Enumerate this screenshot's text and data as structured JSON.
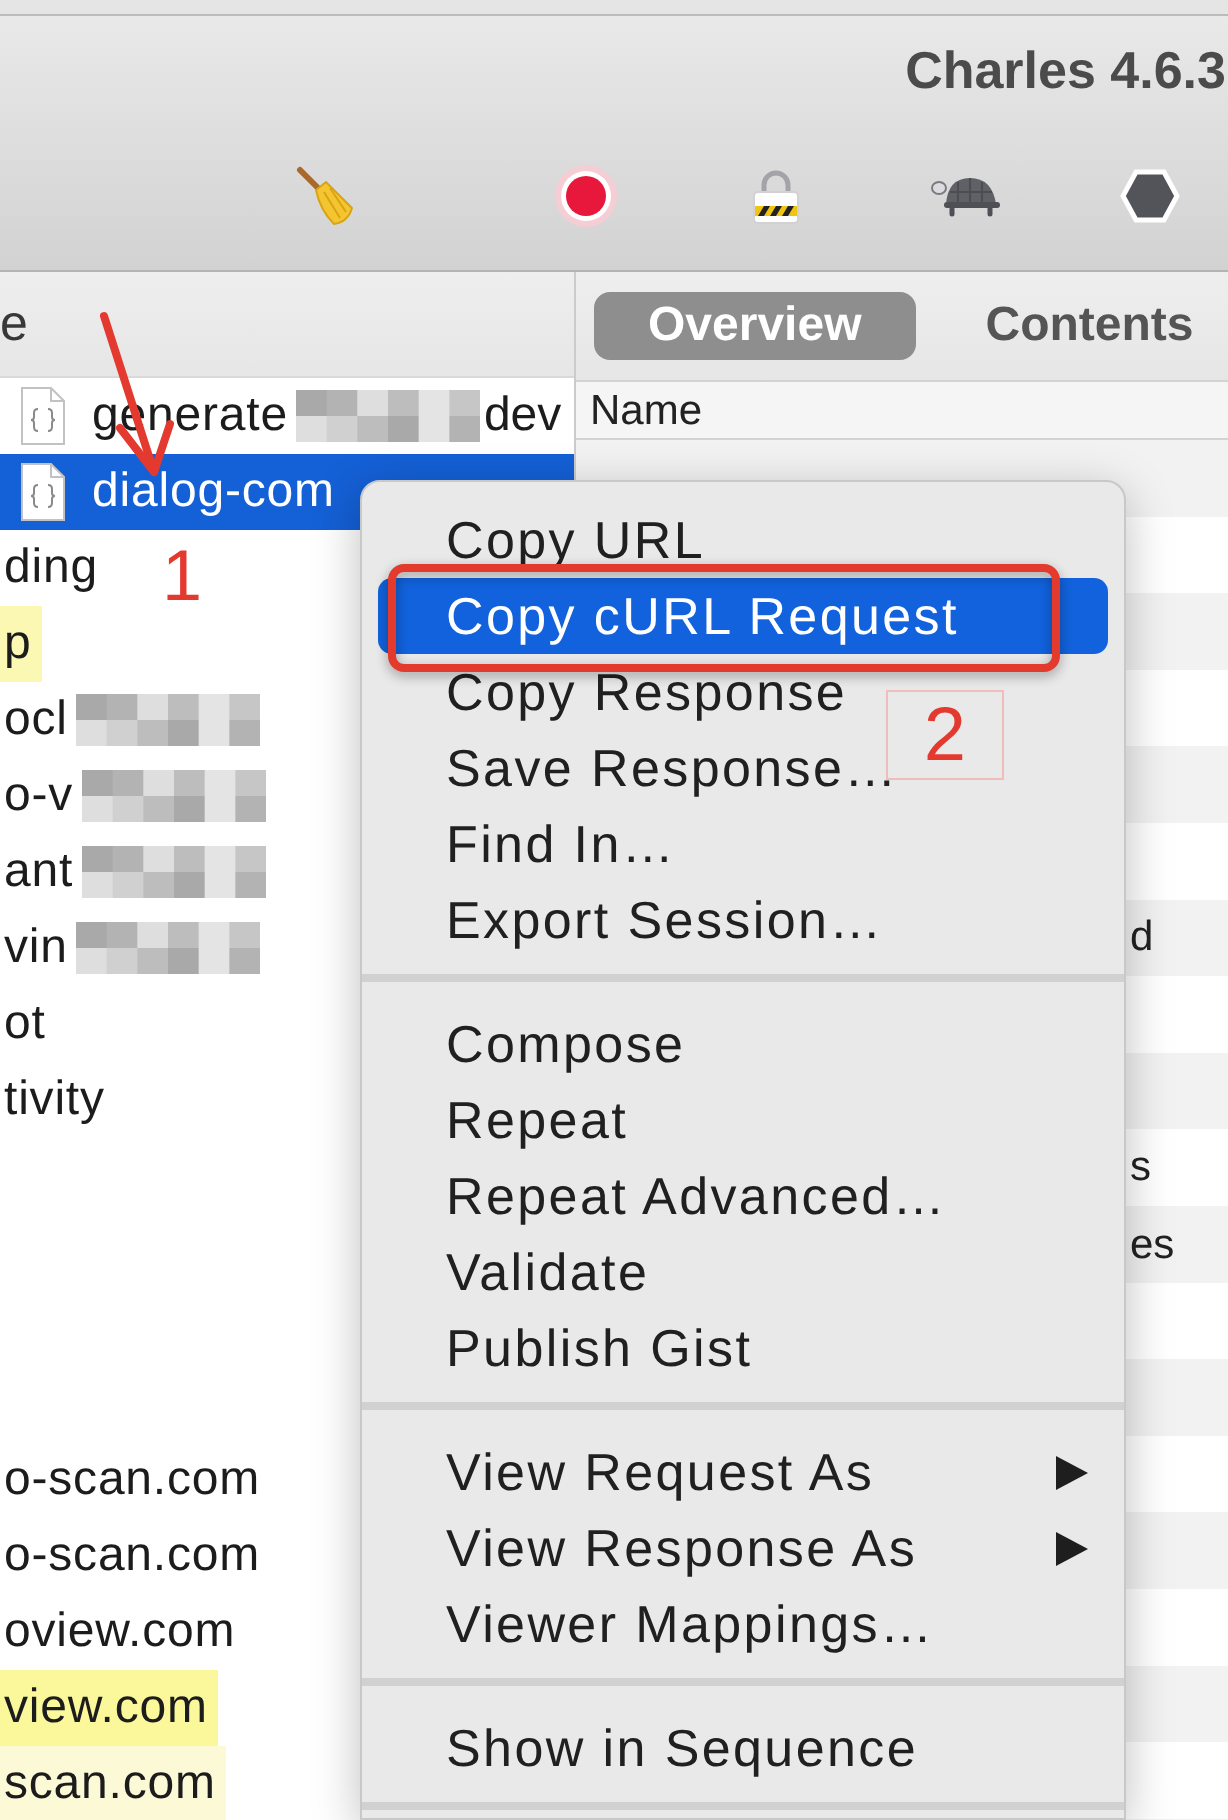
{
  "window": {
    "title": "Charles 4.6.3"
  },
  "structure": {
    "header": "e",
    "rows": [
      {
        "kind": "file",
        "text": "generate",
        "redacted": true,
        "text_after": "dev",
        "selected": false
      },
      {
        "kind": "file",
        "text": "dialog-com",
        "redacted": false,
        "selected": true
      },
      {
        "kind": "host",
        "text": "ding",
        "redacted": false,
        "selected": false
      },
      {
        "kind": "host",
        "text": "p",
        "color": "#fbf8b3",
        "redacted": false,
        "selected": false
      },
      {
        "kind": "host",
        "text": "ocl",
        "redacted": true,
        "selected": false
      },
      {
        "kind": "host",
        "text": "o-v",
        "redacted": true,
        "selected": false
      },
      {
        "kind": "host",
        "text": "ant",
        "redacted": true,
        "selected": false
      },
      {
        "kind": "host",
        "text": "vin",
        "redacted": true,
        "selected": false
      },
      {
        "kind": "host",
        "text": "ot",
        "redacted": false,
        "selected": false
      },
      {
        "kind": "host",
        "text": "tivity",
        "redacted": false,
        "selected": false
      }
    ],
    "lower_rows": [
      {
        "kind": "host",
        "text": "o-scan.com",
        "redacted": false,
        "selected": false
      },
      {
        "kind": "host",
        "text": "o-scan.com",
        "redacted": false,
        "selected": false
      },
      {
        "kind": "host",
        "text": "oview.com",
        "redacted": false,
        "selected": false
      },
      {
        "kind": "host",
        "text": "view.com",
        "color": "#fbf89c",
        "redacted": false,
        "selected": false
      },
      {
        "kind": "host",
        "text": "scan.com",
        "color": "#fcfad6",
        "redacted": false,
        "selected": false
      }
    ]
  },
  "overview": {
    "tabs": [
      {
        "label": "Overview",
        "selected": true
      },
      {
        "label": "Contents",
        "selected": false
      }
    ],
    "column": "Name",
    "cells": [
      "d",
      "s",
      "es"
    ]
  },
  "context_menu": {
    "groups": [
      {
        "items": [
          {
            "label": "Copy URL",
            "selected": false,
            "submenu": false
          },
          {
            "label": "Copy cURL Request",
            "selected": true,
            "submenu": false
          },
          {
            "label": "Copy Response",
            "selected": false,
            "submenu": false
          },
          {
            "label": "Save Response…",
            "selected": false,
            "submenu": false
          },
          {
            "label": "Find In…",
            "selected": false,
            "submenu": false
          },
          {
            "label": "Export Session…",
            "selected": false,
            "submenu": false
          }
        ]
      },
      {
        "items": [
          {
            "label": "Compose",
            "selected": false,
            "submenu": false
          },
          {
            "label": "Repeat",
            "selected": false,
            "submenu": false
          },
          {
            "label": "Repeat Advanced…",
            "selected": false,
            "submenu": false
          },
          {
            "label": "Validate",
            "selected": false,
            "submenu": false
          },
          {
            "label": "Publish Gist",
            "selected": false,
            "submenu": false
          }
        ]
      },
      {
        "items": [
          {
            "label": "View Request As",
            "selected": false,
            "submenu": true
          },
          {
            "label": "View Response As",
            "selected": false,
            "submenu": true
          },
          {
            "label": "Viewer Mappings…",
            "selected": false,
            "submenu": false
          }
        ]
      },
      {
        "items": [
          {
            "label": "Show in Sequence",
            "selected": false,
            "submenu": false
          }
        ]
      }
    ]
  },
  "annotations": [
    {
      "kind": "arrow"
    },
    {
      "kind": "number",
      "text": "1"
    },
    {
      "kind": "frame"
    },
    {
      "kind": "boxed_number",
      "text": "2"
    }
  ]
}
